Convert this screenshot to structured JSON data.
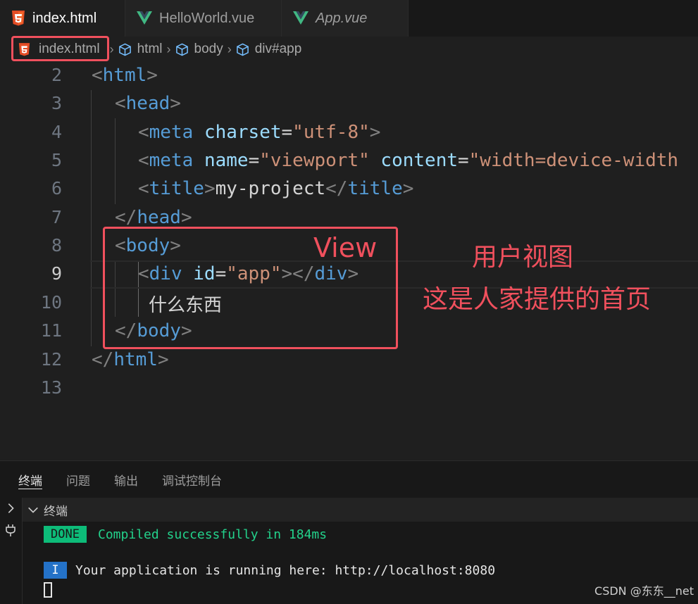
{
  "tabs": [
    {
      "label": "index.html",
      "icon": "html5-icon",
      "active": true
    },
    {
      "label": "HelloWorld.vue",
      "icon": "vue-icon",
      "active": false
    },
    {
      "label": "App.vue",
      "icon": "vue-icon",
      "active": false
    }
  ],
  "breadcrumb": {
    "file": "index.html",
    "items": [
      "html",
      "body",
      "div#app"
    ]
  },
  "editor": {
    "line_numbers": [
      "2",
      "3",
      "4",
      "5",
      "6",
      "7",
      "8",
      "9",
      "10",
      "11",
      "12",
      "13"
    ],
    "current_line": "9",
    "lines": {
      "l4": {
        "tag": "meta",
        "attr": "charset",
        "value": "\"utf-8\""
      },
      "l5": {
        "tag": "meta",
        "attr1": "name",
        "value1": "\"viewport\"",
        "attr2": "content",
        "value2": "\"width=device-width"
      },
      "l6": {
        "tag": "title",
        "text": "my-project"
      },
      "l9": {
        "tag": "div",
        "attr": "id",
        "value": "\"app\""
      },
      "l10": {
        "text": "什么东西"
      }
    },
    "tag_names": {
      "html": "html",
      "head": "head",
      "body": "body",
      "title": "title",
      "div": "div"
    }
  },
  "annotations": {
    "view": "View",
    "user_view": "用户视图",
    "home_page": "这是人家提供的首页"
  },
  "panel": {
    "tabs": [
      "终端",
      "问题",
      "输出",
      "调试控制台"
    ],
    "terminal_title": "终端",
    "done_badge": "DONE",
    "compiled_msg": "Compiled successfully in 184ms",
    "info_badge": "I",
    "running_msg": "Your application is running here: http://localhost:8080"
  },
  "watermark": "CSDN @东东__net",
  "colors": {
    "annotation_red": "#f0505d",
    "tag_blue": "#569cd6",
    "attr_light_blue": "#9cdcfe",
    "string_orange": "#ce9178",
    "done_green": "#0dbc79",
    "info_blue": "#2472c8"
  }
}
